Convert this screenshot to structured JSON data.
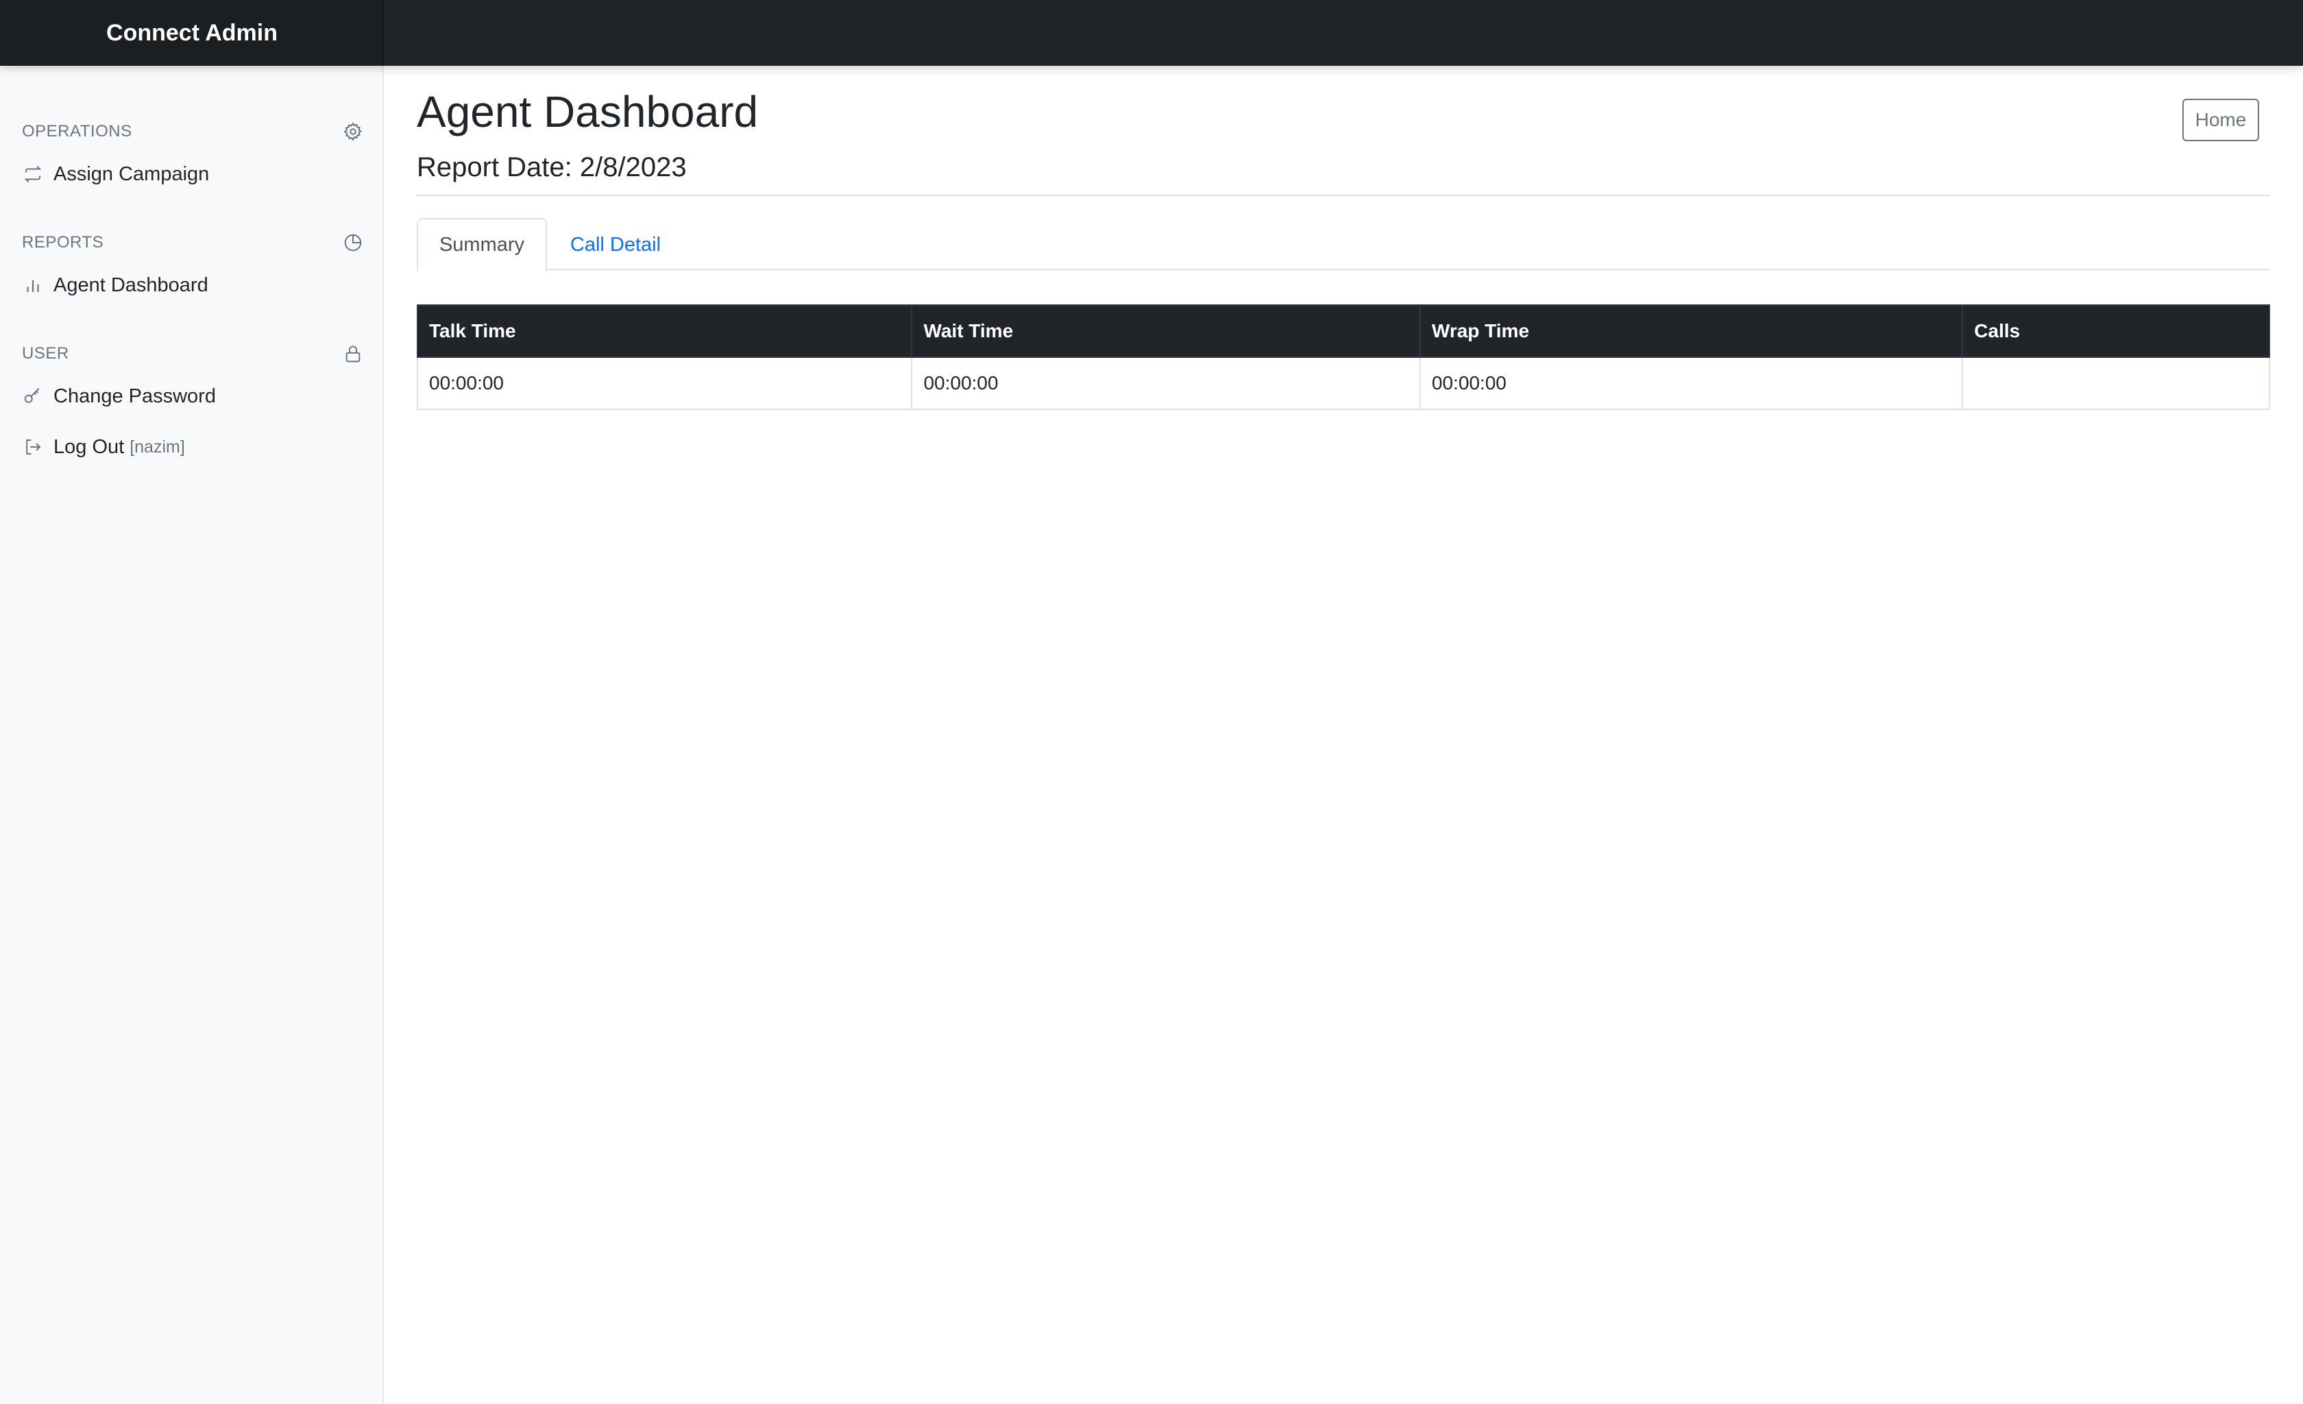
{
  "app": {
    "brand": "Connect Admin"
  },
  "sidebar": {
    "sections": [
      {
        "label": "OPERATIONS",
        "icon": "gear-icon",
        "items": [
          {
            "label": "Assign Campaign",
            "icon": "arrows-repeat-icon"
          }
        ]
      },
      {
        "label": "REPORTS",
        "icon": "pie-chart-icon",
        "items": [
          {
            "label": "Agent Dashboard",
            "icon": "bar-chart-icon"
          }
        ]
      },
      {
        "label": "USER",
        "icon": "lock-icon",
        "items": [
          {
            "label": "Change Password",
            "icon": "key-icon"
          },
          {
            "label": "Log Out",
            "icon": "logout-icon",
            "user": "[nazim]"
          }
        ]
      }
    ]
  },
  "main": {
    "title": "Agent Dashboard",
    "report_date": "Report Date: 2/8/2023",
    "home_button": "Home",
    "tabs": [
      {
        "label": "Summary",
        "active": true
      },
      {
        "label": "Call Detail",
        "active": false
      }
    ],
    "table": {
      "headers": [
        "Talk Time",
        "Wait Time",
        "Wrap Time",
        "Calls"
      ],
      "rows": [
        [
          "00:00:00",
          "00:00:00",
          "00:00:00",
          ""
        ]
      ]
    }
  },
  "colors": {
    "topbar": "#212529",
    "sidebar_bg": "#f8f9fa",
    "link": "#0d6efd",
    "table_header": "#212529"
  }
}
